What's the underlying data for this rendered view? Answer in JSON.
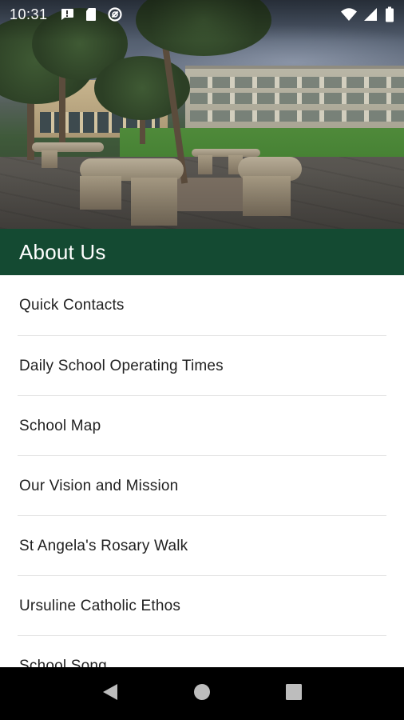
{
  "status_bar": {
    "time": "10:31",
    "left_icons": [
      "message-icon",
      "sd-card-icon",
      "data-saver-icon"
    ],
    "right_icons": [
      "wifi-icon",
      "cell-signal-icon",
      "battery-icon"
    ]
  },
  "hero": {
    "image": "school-courtyard-photo"
  },
  "header": {
    "title": "About Us",
    "color": "#144a32"
  },
  "menu": {
    "items": [
      {
        "label": "Quick Contacts"
      },
      {
        "label": "Daily School Operating Times"
      },
      {
        "label": "School Map"
      },
      {
        "label": "Our Vision and Mission"
      },
      {
        "label": "St Angela's Rosary Walk"
      },
      {
        "label": "Ursuline Catholic Ethos"
      },
      {
        "label": "School Song"
      }
    ]
  },
  "nav_bar": {
    "buttons": [
      "back-icon",
      "home-icon",
      "recents-icon"
    ]
  }
}
